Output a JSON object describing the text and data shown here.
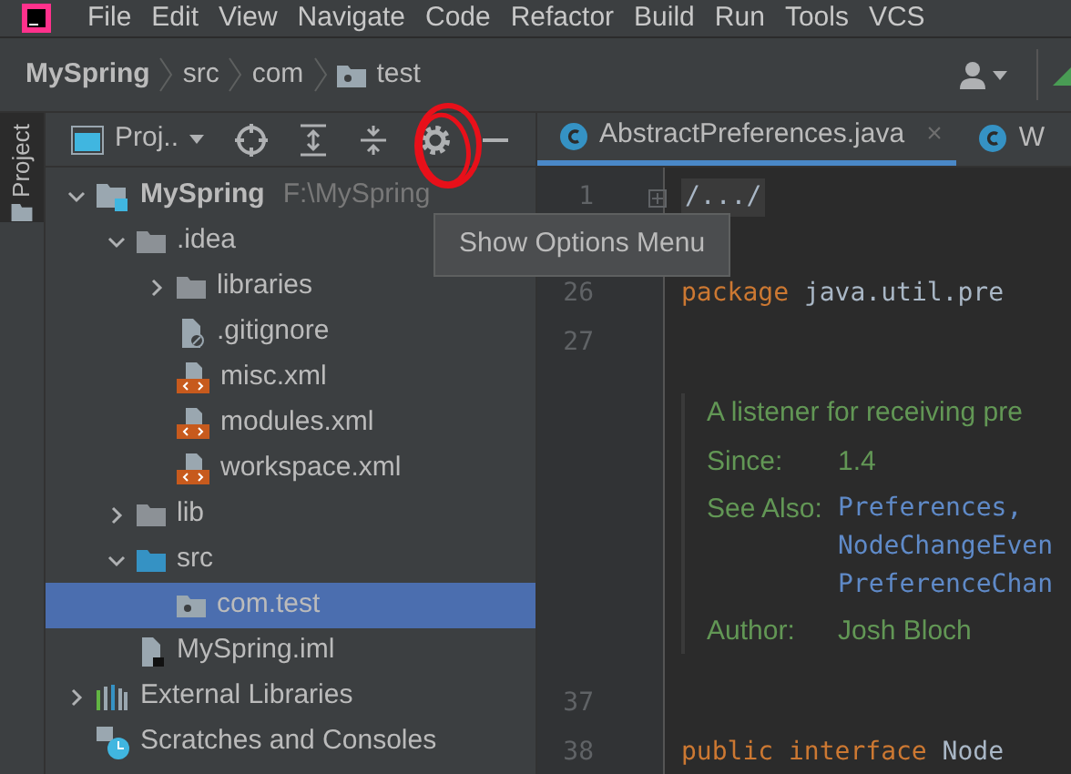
{
  "menu_bar": {
    "items": [
      "File",
      "Edit",
      "View",
      "Navigate",
      "Code",
      "Refactor",
      "Build",
      "Run",
      "Tools",
      "VCS"
    ]
  },
  "breadcrumbs": [
    {
      "label": "MySpring",
      "kind": "project"
    },
    {
      "label": "src",
      "kind": "plain"
    },
    {
      "label": "com",
      "kind": "plain"
    },
    {
      "label": "test",
      "kind": "package"
    }
  ],
  "side_stripe": {
    "tab": "Project"
  },
  "project_panel": {
    "view_selector": "Proj..",
    "tree": [
      {
        "label": "MySpring",
        "hint": "F:\\MySpring",
        "kind": "module",
        "expanded": true,
        "selected": false,
        "children": [
          {
            "label": ".idea",
            "kind": "folder",
            "expanded": true,
            "selected": false,
            "children": [
              {
                "label": "libraries",
                "kind": "folder",
                "expanded": false,
                "selected": false
              },
              {
                "label": ".gitignore",
                "kind": "ignore-file",
                "selected": false
              },
              {
                "label": "misc.xml",
                "kind": "xml-file",
                "selected": false
              },
              {
                "label": "modules.xml",
                "kind": "xml-file",
                "selected": false
              },
              {
                "label": "workspace.xml",
                "kind": "xml-file",
                "selected": false
              }
            ]
          },
          {
            "label": "lib",
            "kind": "folder",
            "expanded": false,
            "selected": false
          },
          {
            "label": "src",
            "kind": "source-folder",
            "expanded": true,
            "selected": false,
            "children": [
              {
                "label": "com.test",
                "kind": "package",
                "selected": true
              }
            ]
          },
          {
            "label": "MySpring.iml",
            "kind": "iml-file",
            "selected": false
          }
        ]
      },
      {
        "label": "External Libraries",
        "kind": "libraries",
        "expanded": false,
        "selected": false
      },
      {
        "label": "Scratches and Consoles",
        "kind": "scratches",
        "selected": false
      }
    ]
  },
  "tooltip": "Show Options Menu",
  "editor_tabs": [
    {
      "label": "AbstractPreferences.java",
      "close": "×",
      "selected": true
    },
    {
      "label": "W",
      "selected": false
    }
  ],
  "editor": {
    "lines": [
      {
        "number": "1",
        "kind": "fold",
        "tokens": [
          {
            "text": "/.../",
            "kind": "plain"
          }
        ]
      },
      {
        "number": "26",
        "kind": "code",
        "tokens": [
          {
            "text": "package",
            "kind": "keyword"
          },
          {
            "text": "java.util.pre",
            "kind": "plain"
          }
        ]
      },
      {
        "number": "27",
        "kind": "code"
      },
      {
        "kind": "doc",
        "description": "A listener for receiving pre",
        "fields": [
          {
            "label": "Since:",
            "values": [
              {
                "text": "1.4",
                "kind": "text"
              }
            ]
          },
          {
            "label": "See Also:",
            "values": [
              {
                "text": "Preferences,",
                "kind": "link"
              },
              {
                "text": "NodeChangeEven",
                "kind": "link"
              },
              {
                "text": "PreferenceChan",
                "kind": "link"
              }
            ]
          },
          {
            "label": "Author:",
            "values": [
              {
                "text": "Josh Bloch",
                "kind": "text"
              }
            ]
          }
        ]
      },
      {
        "number": "37",
        "kind": "code"
      },
      {
        "number": "38",
        "kind": "code",
        "tokens": [
          {
            "text": "public",
            "kind": "keyword"
          },
          {
            "text": "interface",
            "kind": "keyword"
          },
          {
            "text": "Node",
            "kind": "plain"
          }
        ]
      }
    ]
  }
}
